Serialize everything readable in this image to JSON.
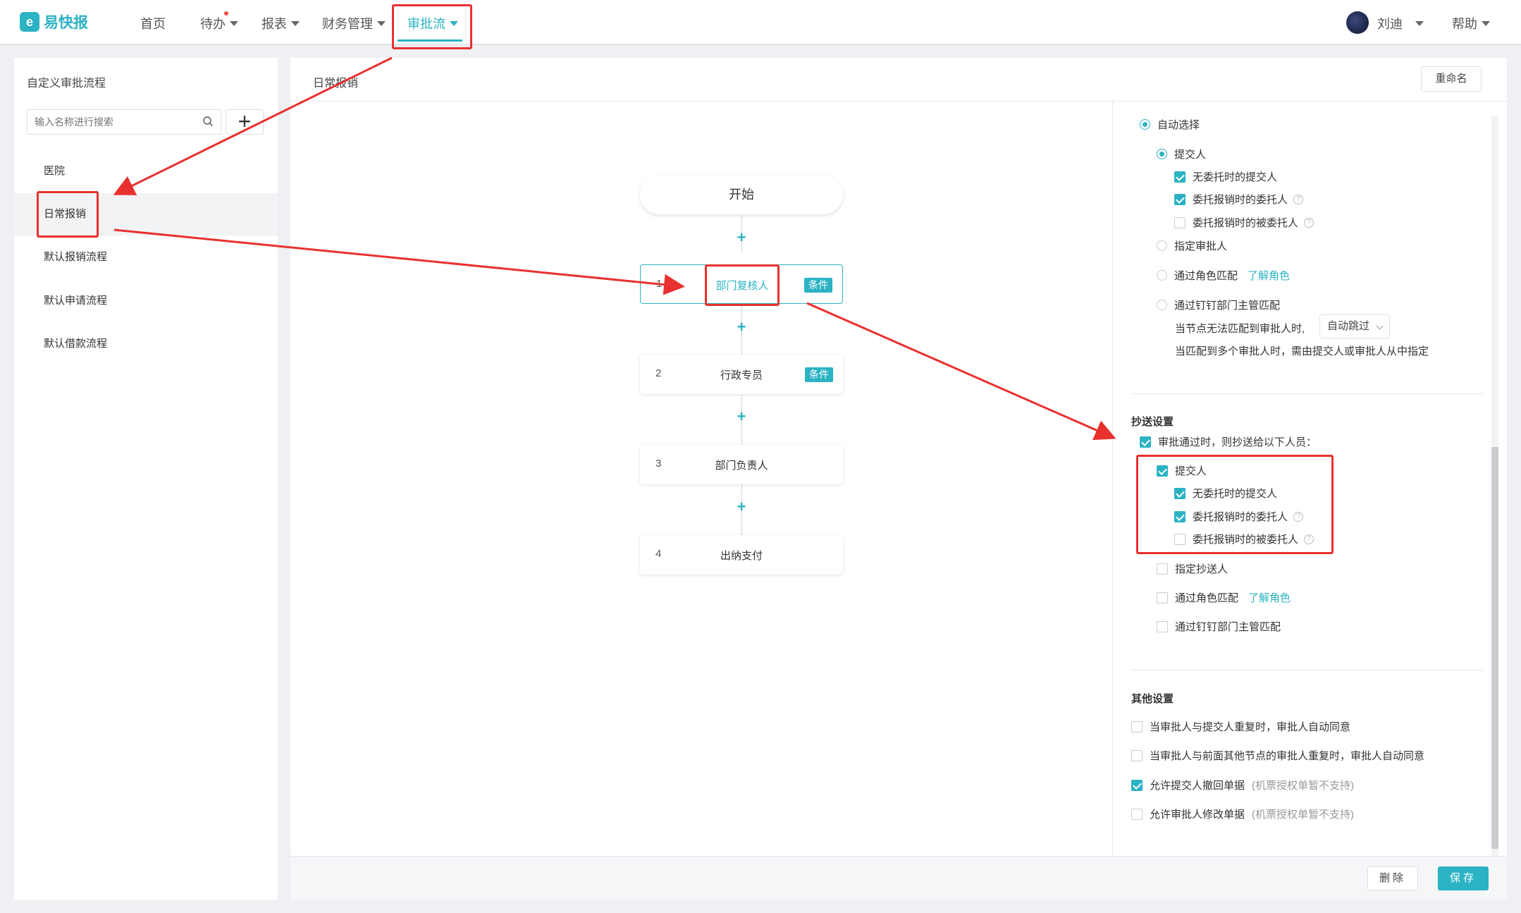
{
  "nav": {
    "logo_text": "易快报",
    "items": [
      {
        "label": "首页"
      },
      {
        "label": "待办"
      },
      {
        "label": "报表"
      },
      {
        "label": "财务管理"
      },
      {
        "label": "审批流"
      }
    ],
    "user_name": "刘迪",
    "help_label": "帮助"
  },
  "sidebar": {
    "title": "自定义审批流程",
    "search_placeholder": "输入名称进行搜索",
    "add_symbol": "+",
    "items": [
      {
        "label": "医院"
      },
      {
        "label": "日常报销"
      },
      {
        "label": "默认报销流程"
      },
      {
        "label": "默认申请流程"
      },
      {
        "label": "默认借款流程"
      }
    ]
  },
  "main": {
    "title": "日常报销",
    "rename_label": "重命名",
    "start_label": "开始",
    "nodes": [
      {
        "num": "1",
        "label": "部门复核人",
        "badge": "条件"
      },
      {
        "num": "2",
        "label": "行政专员",
        "badge": "条件"
      },
      {
        "num": "3",
        "label": "部门负责人",
        "badge": ""
      },
      {
        "num": "4",
        "label": "出纳支付",
        "badge": ""
      }
    ]
  },
  "config": {
    "approver": {
      "auto_select": "自动选择",
      "submitter": "提交人",
      "no_delegate_submitter": "无委托时的提交人",
      "delegate_principal": "委托报销时的委托人",
      "delegate_agent": "委托报销时的被委托人",
      "specify_approver": "指定审批人",
      "role_match": "通过角色匹配",
      "learn_role": "了解角色",
      "dingtalk_match": "通过钉钉部门主管匹配",
      "no_match_text": "当节点无法匹配到审批人时,",
      "no_match_value": "自动跳过",
      "multi_match_text": "当匹配到多个审批人时，需由提交人或审批人从中指定"
    },
    "cc": {
      "title": "抄送设置",
      "on_approve": "审批通过时，则抄送给以下人员：",
      "submitter": "提交人",
      "no_delegate_submitter": "无委托时的提交人",
      "delegate_principal": "委托报销时的委托人",
      "delegate_agent": "委托报销时的被委托人",
      "specify_cc": "指定抄送人",
      "role_match": "通过角色匹配",
      "learn_role": "了解角色",
      "dingtalk_match": "通过钉钉部门主管匹配"
    },
    "other": {
      "title": "其他设置",
      "opt1": "当审批人与提交人重复时，审批人自动同意",
      "opt2": "当审批人与前面其他节点的审批人重复时，审批人自动同意",
      "opt3": "允许提交人撤回单据",
      "opt3_note": "(机票授权单暂不支持)",
      "opt4": "允许审批人修改单据",
      "opt4_note": "(机票授权单暂不支持)"
    }
  },
  "footer": {
    "delete_label": "删除",
    "save_label": "保存"
  },
  "colors": {
    "accent": "#2bb3c3",
    "annotation_red": "#e8312e"
  }
}
